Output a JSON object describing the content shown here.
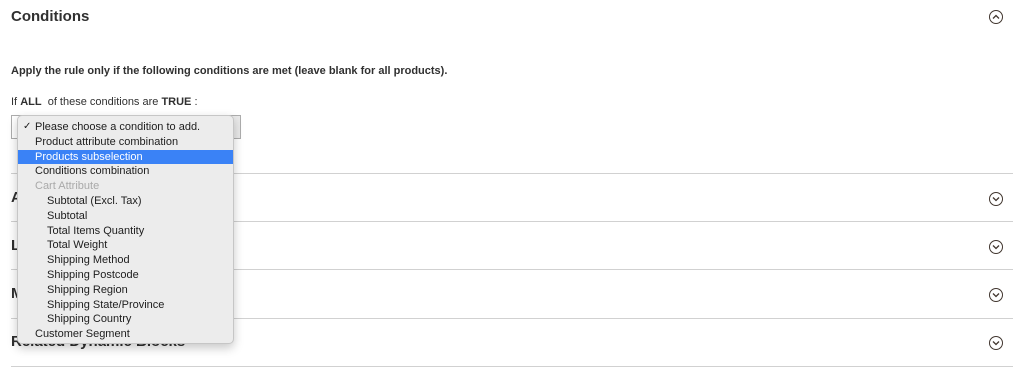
{
  "conditions_section": {
    "title": "Conditions",
    "intro": "Apply the rule only if the following conditions are met (leave blank for all products).",
    "cond_prefix": "If",
    "aggregator": "ALL",
    "cond_middle": "of these conditions are",
    "value": "TRUE",
    "cond_suffix": ":"
  },
  "dropdown": {
    "selected_index": 2,
    "options": [
      "Please choose a condition to add.",
      "Product attribute combination",
      "Products subselection",
      "Conditions combination",
      "Cart Attribute",
      "Subtotal (Excl. Tax)",
      "Subtotal",
      "Total Items Quantity",
      "Total Weight",
      "Shipping Method",
      "Shipping Postcode",
      "Shipping Region",
      "Shipping State/Province",
      "Shipping Country",
      "Customer Segment"
    ]
  },
  "collapsed_sections": [
    {
      "title": "A"
    },
    {
      "title": "L"
    },
    {
      "title": "M"
    },
    {
      "title": "Related Dynamic Blocks"
    }
  ],
  "colors": {
    "highlight": "#3a82f6",
    "divider": "#d1d1d1",
    "icon": "#41362f"
  },
  "icons": {
    "collapse": "chevron-up-circle-icon",
    "expand": "chevron-down-circle-icon"
  }
}
